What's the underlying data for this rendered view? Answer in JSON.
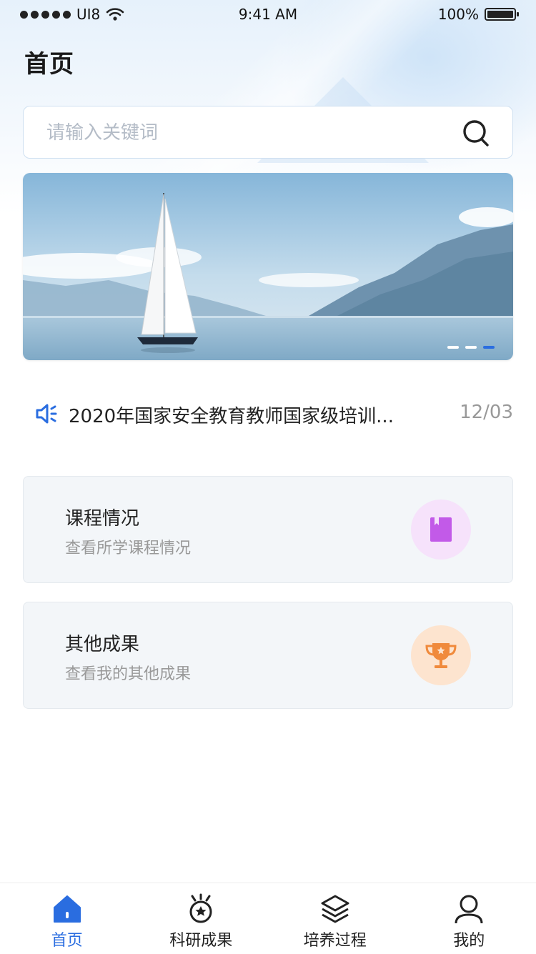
{
  "status_bar": {
    "carrier": "UI8",
    "time": "9:41 AM",
    "battery": "100%",
    "battery_level": 1.0
  },
  "header": {
    "title": "首页"
  },
  "search": {
    "placeholder": "请输入关键词",
    "value": "",
    "icon": "search-icon"
  },
  "banner": {
    "alt_scene": "sailboat-on-lake",
    "slide_count": 3,
    "active_slide_index": 2
  },
  "notice": {
    "icon": "speaker-icon",
    "text": "2020年国家安全教育教师国家级培训...",
    "date": "12/03"
  },
  "cards": [
    {
      "title": "课程情况",
      "subtitle": "查看所学课程情况",
      "icon": "book-icon",
      "icon_color": "#c25ae8",
      "circle_color": "#f6e2fb"
    },
    {
      "title": "其他成果",
      "subtitle": "查看我的其他成果",
      "icon": "trophy-icon",
      "icon_color": "#f08a3c",
      "circle_color": "#fde4cf"
    }
  ],
  "tabbar": {
    "items": [
      {
        "label": "首页",
        "icon": "home-icon",
        "active": true
      },
      {
        "label": "科研成果",
        "icon": "medal-icon",
        "active": false
      },
      {
        "label": "培养过程",
        "icon": "layers-icon",
        "active": false
      },
      {
        "label": "我的",
        "icon": "user-icon",
        "active": false
      }
    ]
  },
  "colors": {
    "accent": "#2a6de0",
    "card_bg": "#f3f6f9",
    "muted_text": "#999999"
  }
}
